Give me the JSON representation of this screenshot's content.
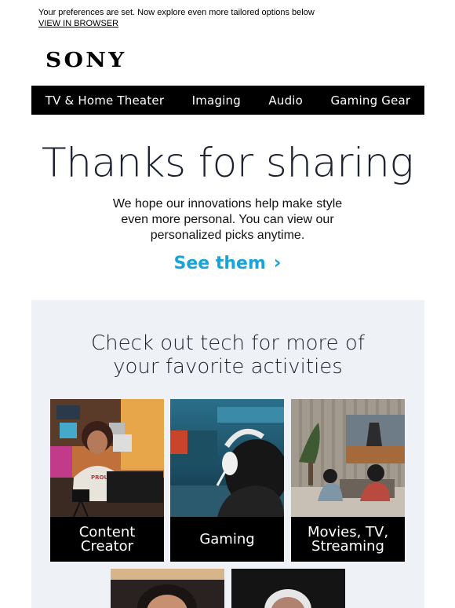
{
  "preheader": {
    "message": "Your preferences are set. Now explore even more tailored options below",
    "view_in_browser": "VIEW IN BROWSER"
  },
  "brand": {
    "logo": "SONY"
  },
  "nav": {
    "items": [
      {
        "label": "TV & Home Theater"
      },
      {
        "label": "Imaging"
      },
      {
        "label": "Audio"
      },
      {
        "label": "Gaming Gear"
      }
    ]
  },
  "hero": {
    "title": "Thanks for sharing",
    "body": "We hope our innovations help make style even more personal. You can view our personalized picks anytime.",
    "cta_label": "See them",
    "cta_chevron": "›",
    "cta_color": "#1aa3d9"
  },
  "activities": {
    "title_line1": "Check out tech for more of",
    "title_line2": "your favorite activities",
    "tiles": [
      {
        "label_line1": "Content",
        "label_line2": "Creator",
        "image_text": "PROUD MAN"
      },
      {
        "label_line1": "Gaming",
        "label_line2": ""
      },
      {
        "label_line1": "Movies, TV,",
        "label_line2": "Streaming"
      }
    ]
  },
  "colors": {
    "nav_bg": "#000000",
    "panel_bg": "#eef1f6",
    "headline": "#1c2230"
  }
}
